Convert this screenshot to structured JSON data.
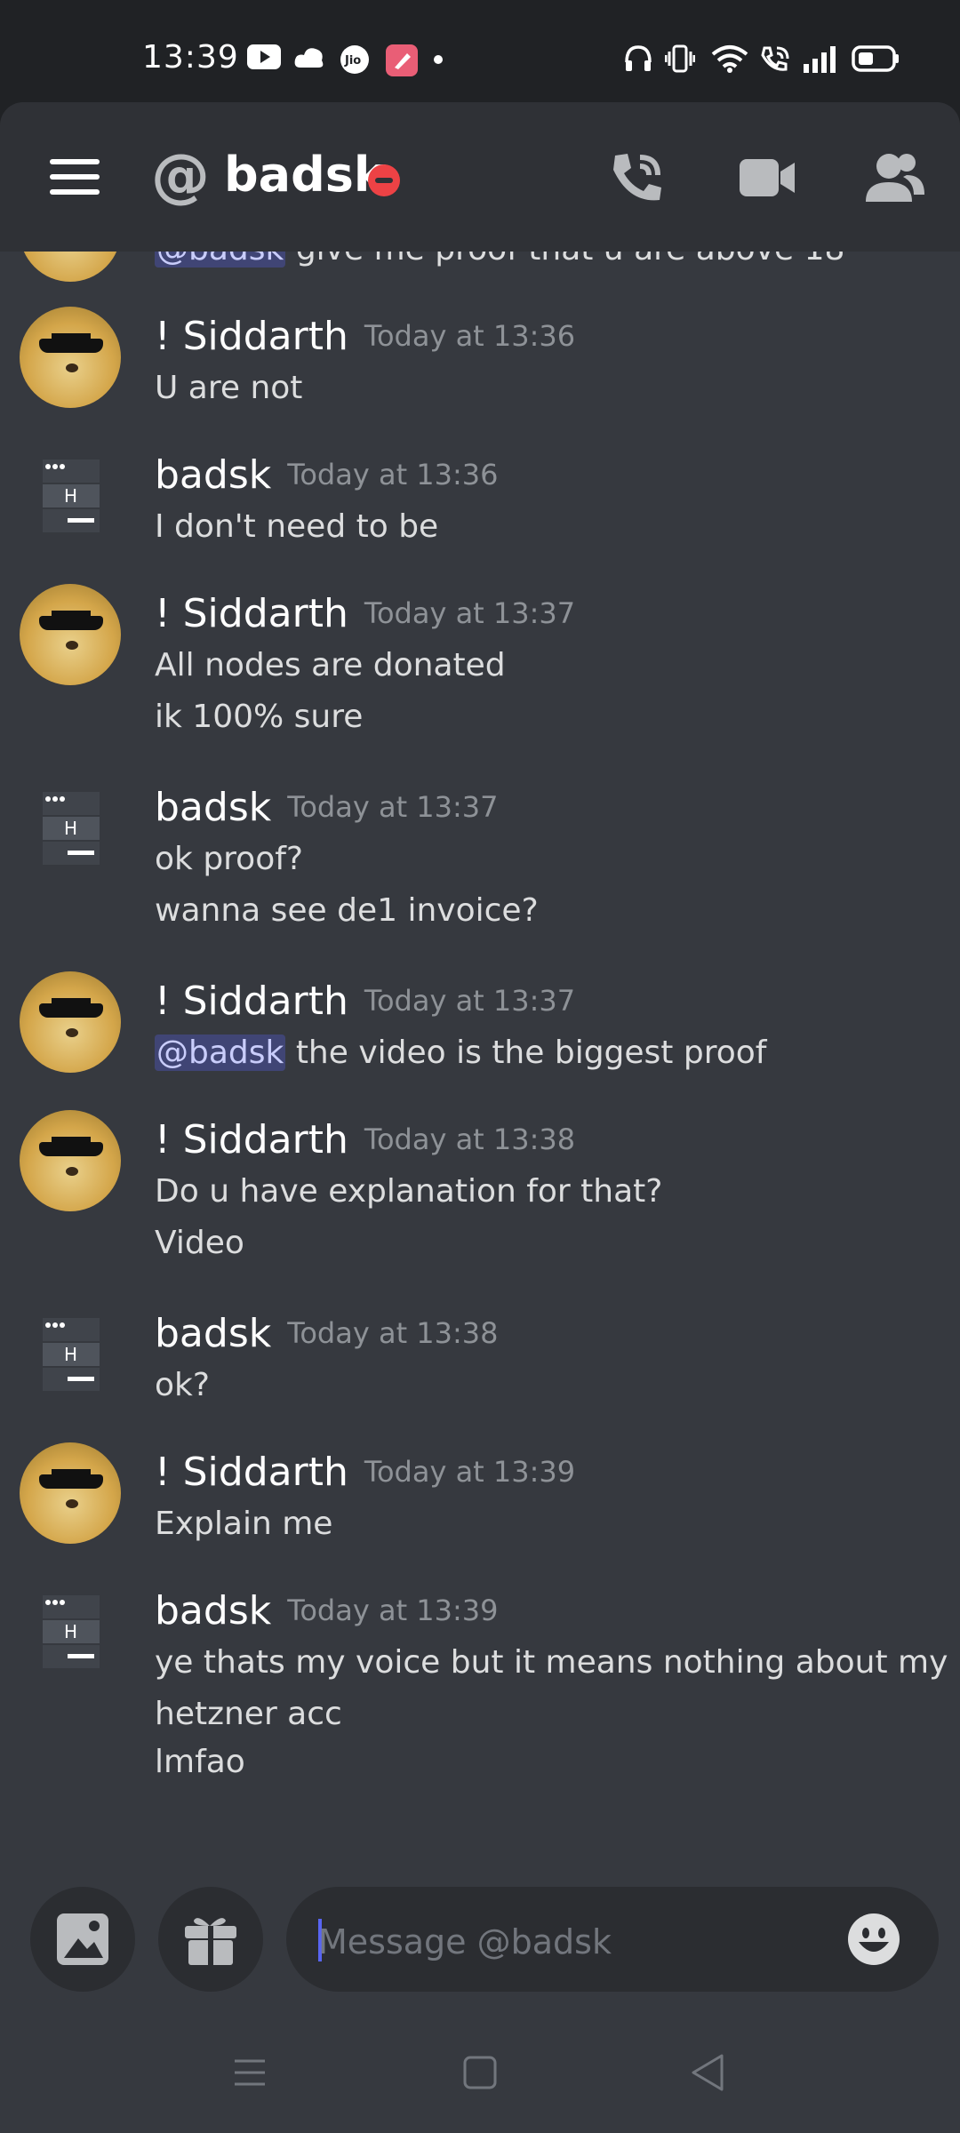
{
  "status_bar": {
    "time": "13:39",
    "icons": [
      "youtube-icon",
      "cloud-game-icon",
      "jio-icon",
      "app-icon",
      "dot-icon",
      "headphones-icon",
      "vibrate-icon",
      "wifi-icon",
      "wifi-call-icon",
      "signal-icon",
      "battery-icon"
    ]
  },
  "header": {
    "at_symbol": "@",
    "channel_name": "badsk",
    "status": "do-not-disturb",
    "status_color": "#ed4245"
  },
  "messages": [
    {
      "author": "",
      "timestamp": "",
      "lines": [
        {
          "mention": "@badsk",
          "text": " give me proof that u are above 18"
        }
      ],
      "partial": true
    },
    {
      "author": "! Siddarth",
      "timestamp": "Today at 13:36",
      "avatar": "doge",
      "lines": [
        {
          "text": "U are not"
        }
      ]
    },
    {
      "author": "badsk",
      "timestamp": "Today at 13:36",
      "avatar": "server",
      "lines": [
        {
          "text": "I don't need to be"
        }
      ]
    },
    {
      "author": "! Siddarth",
      "timestamp": "Today at 13:37",
      "avatar": "doge",
      "lines": [
        {
          "text": "All nodes are donated"
        },
        {
          "text": "ik 100% sure"
        }
      ]
    },
    {
      "author": "badsk",
      "timestamp": "Today at 13:37",
      "avatar": "server",
      "lines": [
        {
          "text": "ok proof?"
        },
        {
          "text": "wanna see de1 invoice?"
        }
      ]
    },
    {
      "author": "! Siddarth",
      "timestamp": "Today at 13:37",
      "avatar": "doge",
      "lines": [
        {
          "mention": "@badsk",
          "text": " the video is the biggest proof"
        }
      ]
    },
    {
      "author": "! Siddarth",
      "timestamp": "Today at 13:38",
      "avatar": "doge",
      "lines": [
        {
          "text": "Do u have explanation for that?"
        },
        {
          "text": "Video"
        }
      ]
    },
    {
      "author": "badsk",
      "timestamp": "Today at 13:38",
      "avatar": "server",
      "lines": [
        {
          "text": "ok?"
        }
      ]
    },
    {
      "author": "! Siddarth",
      "timestamp": "Today at 13:39",
      "avatar": "doge",
      "lines": [
        {
          "text": "Explain me"
        }
      ]
    },
    {
      "author": "badsk",
      "timestamp": "Today at 13:39",
      "avatar": "server",
      "lines": [
        {
          "text": "ye thats my voice but it means nothing about my"
        },
        {
          "text": "hetzner acc"
        },
        {
          "text": "lmfao"
        }
      ]
    }
  ],
  "composer": {
    "placeholder": "Message @badsk"
  },
  "colors": {
    "background": "#36393f",
    "header": "#2f3136",
    "accent": "#5865f2",
    "mention_text": "#c9cdfb"
  }
}
